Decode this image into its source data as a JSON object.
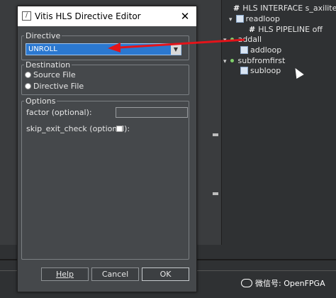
{
  "dialog": {
    "title": "Vitis HLS Directive Editor",
    "close_glyph": "✕",
    "directive_group": {
      "label": "Directive",
      "selected": "UNROLL"
    },
    "destination_group": {
      "label": "Destination",
      "source_file": "Source File",
      "directive_file": "Directive File"
    },
    "options_group": {
      "label": "Options",
      "factor_label": "factor (optional):",
      "factor_value": "",
      "skip_exit_check_label": "skip_exit_check (optional):",
      "skip_exit_check_checked": false
    },
    "buttons": {
      "help": "Help",
      "cancel": "Cancel",
      "ok": "OK"
    }
  },
  "outline": {
    "items": [
      {
        "text": "HLS INTERFACE s_axilite pc",
        "type": "pragma"
      },
      {
        "text": "readloop",
        "type": "loop"
      },
      {
        "text": "HLS PIPELINE off",
        "type": "pragma"
      },
      {
        "text": "addall",
        "type": "function"
      },
      {
        "text": "addloop",
        "type": "loop"
      },
      {
        "text": "subfromfirst",
        "type": "function"
      },
      {
        "text": "subloop",
        "type": "loop"
      }
    ]
  },
  "annotation": {
    "color": "#e3141a"
  },
  "watermark": {
    "text": "微信号: OpenFPGA"
  },
  "colors": {
    "selection_blue": "#2b78d0",
    "dialog_bg": "#45484b",
    "tree_bg": "#2f3133"
  }
}
